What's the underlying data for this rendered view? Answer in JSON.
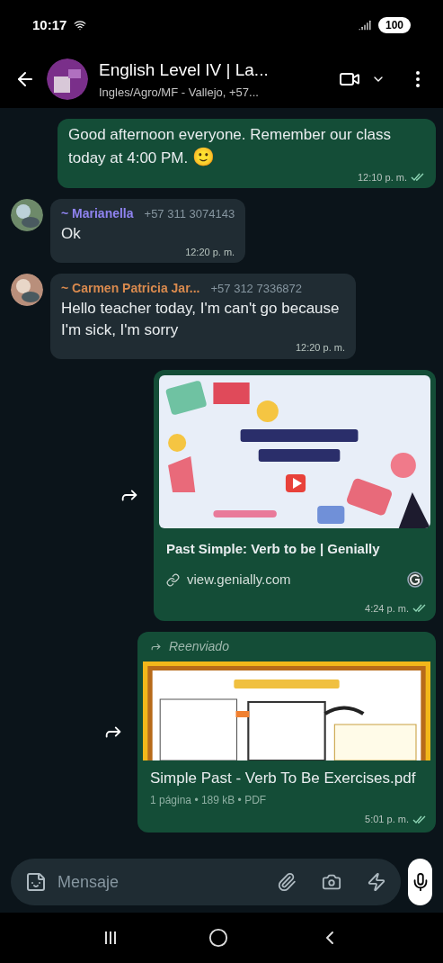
{
  "status_bar": {
    "time": "10:17",
    "battery": "100"
  },
  "header": {
    "title": "English Level IV | La...",
    "subtitle": "Ingles/Agro/MF - Vallejo, +57..."
  },
  "messages": [
    {
      "kind": "text_out",
      "text": "Good afternoon everyone. Remember our class today at 4:00 PM.",
      "emoji": "🙂",
      "time": "12:10 p. m.",
      "read": true
    },
    {
      "kind": "text_in",
      "sender": "~ Marianella",
      "color": "#8f83f0",
      "phone": "+57 311 3074143",
      "text": "Ok",
      "time": "12:20 p. m."
    },
    {
      "kind": "text_in",
      "sender": "~ Carmen Patricia Jar...",
      "color": "#d98a4e",
      "phone": "+57 312 7336872",
      "text": "Hello teacher today, I'm can't go because I'm sick, I'm sorry",
      "time": "12:20 p. m."
    },
    {
      "kind": "link",
      "title": "Past Simple: Verb to be | Genially",
      "url": "view.genially.com",
      "time": "4:24 p. m.",
      "read": true
    },
    {
      "kind": "document",
      "forwarded_label": "Reenviado",
      "file": "Simple Past -  Verb To Be Exercises.pdf",
      "meta": "1 página • 189 kB • PDF",
      "time": "5:01 p. m.",
      "read": true
    }
  ],
  "composer": {
    "placeholder": "Mensaje"
  }
}
